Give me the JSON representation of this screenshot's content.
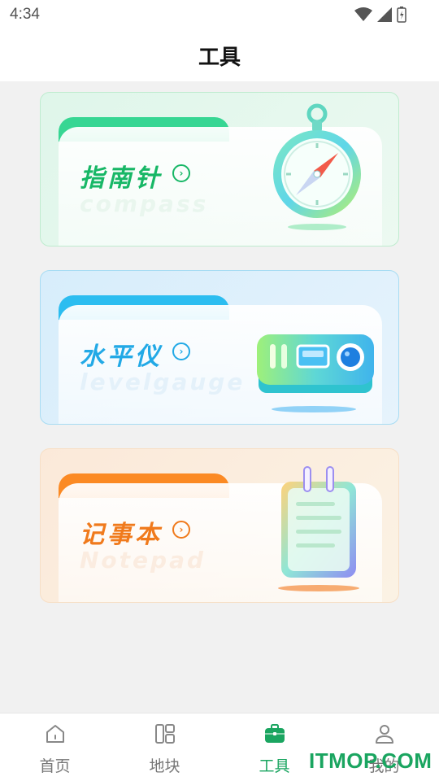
{
  "status_bar": {
    "time": "4:34"
  },
  "header": {
    "title": "工具"
  },
  "tools": [
    {
      "label": "指南针",
      "sublabel": "compass"
    },
    {
      "label": "水平仪",
      "sublabel": "levelgauge"
    },
    {
      "label": "记事本",
      "sublabel": "Notepad"
    }
  ],
  "tab_bar": {
    "items": [
      {
        "label": "首页",
        "icon": "home-icon",
        "active": false
      },
      {
        "label": "地块",
        "icon": "plots-icon",
        "active": false
      },
      {
        "label": "工具",
        "icon": "briefcase-icon",
        "active": true
      },
      {
        "label": "我的",
        "icon": "user-icon",
        "active": false
      }
    ]
  },
  "watermark": "ITMOP.COM",
  "colors": {
    "accent": "#1aa560",
    "compass": "#17b766",
    "level": "#22a9e6",
    "notepad": "#f07a1c"
  }
}
